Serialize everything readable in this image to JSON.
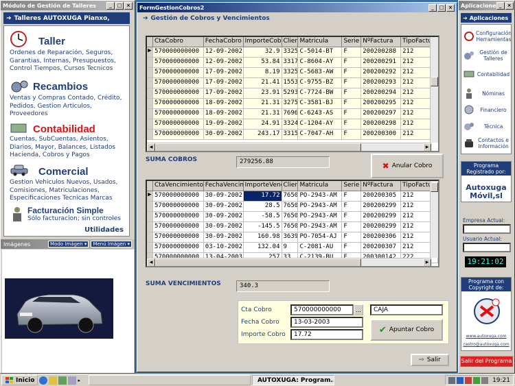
{
  "left_window": {
    "title": "Módulo de Gestión de Talleres",
    "header": "Talleres AUTOXUGA Pianxo,",
    "sections": [
      {
        "title": "Taller",
        "desc": "Ordenes de Reparación, Seguros, Garantias, Internas, Presupuestos, Control Tiempos, Cursos Tecnicos",
        "color": "#1f3d7a"
      },
      {
        "title": "Recambios",
        "desc": "Ventas y Compras Contado, Crédito, Pedidos,  Gestion Articulos, Proveedores",
        "color": "#1f3d7a"
      },
      {
        "title": "Contabilidad",
        "desc": "Cuentas, SubCuentas, Asientos, Diarios, Mayor, Balances, Listados Hacienda, Cobros y Pagos",
        "color": "#e01010"
      },
      {
        "title": "Comercial",
        "desc": "Gestion Vehiculos Nuevos, Usados, Comisiones, Matriculaciones, Especificaciones Tecnicas Marcas",
        "color": "#1f3d7a"
      },
      {
        "title": "Facturación Simple",
        "desc": "Sólo facturacion; sin controles",
        "color": "#1f3d7a"
      }
    ],
    "utilidades": "Utilidades",
    "images_bar": {
      "title": "Imágenes",
      "mode_btn": "Modo Imágen",
      "menu_btn": "Menú Imágen"
    }
  },
  "main_window": {
    "title": "FormGestionCobros2",
    "header": "Gestión de Cobros y Vencimientos",
    "cobros_columns": [
      "CtaCobro",
      "FechaCobro",
      "ImporteCobro",
      "Cliente",
      "Matricula",
      "Serie",
      "NºFactura",
      "TipoFactura"
    ],
    "cobros_rows": [
      [
        "570000000000",
        "12-09-2002",
        "32.9",
        "3325",
        "C-5014-BT",
        "F",
        "200200288",
        "212"
      ],
      [
        "570000000000",
        "12-09-2002",
        "53.84",
        "3317",
        "C-8604-AY",
        "F",
        "200200291",
        "212"
      ],
      [
        "570000000000",
        "17-09-2002",
        "8.19",
        "3325",
        "C-5683-AW",
        "F",
        "200200292",
        "212"
      ],
      [
        "570000000000",
        "17-09-2002",
        "21.41",
        "1553",
        "C-9755-BZ",
        "F",
        "200200293",
        "212"
      ],
      [
        "570000000000",
        "17-09-2002",
        "23.91",
        "5293",
        "C-7724-BW",
        "F",
        "200200294",
        "212"
      ],
      [
        "570000000000",
        "18-09-2002",
        "21.31",
        "3275",
        "C-3581-BJ",
        "F",
        "200200295",
        "212"
      ],
      [
        "570000000000",
        "18-09-2002",
        "21.31",
        "7696",
        "C-6243-AS",
        "F",
        "200200297",
        "212"
      ],
      [
        "570000000000",
        "19-09-2002",
        "24.91",
        "3324",
        "C-1204-AY",
        "F",
        "200200298",
        "212"
      ],
      [
        "570000000000",
        "30-09-2002",
        "243.17",
        "3315",
        "C-7047-AH",
        "F",
        "200200300",
        "212"
      ]
    ],
    "suma_cobros_label": "SUMA COBROS",
    "suma_cobros_value": "279256.88",
    "anular_label": "Anular Cobro",
    "venc_columns": [
      "CtaVencimiento",
      "FechaVencimiento",
      "ImporteVencimiento",
      "Cliente",
      "Matricula",
      "Serie",
      "NºFactura",
      "TipoFactura"
    ],
    "venc_rows": [
      [
        "570000000000",
        "30-09-2002",
        "17.72",
        "7650",
        "PO-2943-AM",
        "F",
        "200200305",
        "212"
      ],
      [
        "570000000000",
        "30-09-2002",
        "28.5",
        "7650",
        "PO-2943-AM",
        "F",
        "200200299",
        "212"
      ],
      [
        "570000000000",
        "30-09-2002",
        "-58.5",
        "7650",
        "PO-2943-AM",
        "F",
        "200200299",
        "212"
      ],
      [
        "570000000000",
        "30-09-2002",
        "-145.5",
        "7650",
        "PO-2943-AM",
        "F",
        "200200299",
        "212"
      ],
      [
        "570000000000",
        "30-09-2002",
        "160.98",
        "3639",
        "PO-7054-AJ",
        "F",
        "200200306",
        "212"
      ],
      [
        "570000000000",
        "03-10-2002",
        "132.04",
        "9",
        "C-2081-AU",
        "F",
        "200200307",
        "212"
      ],
      [
        "570000000000",
        "13-04-2003",
        "257",
        "33",
        "C-2139-BU",
        "F",
        "200300142",
        "222"
      ]
    ],
    "suma_venc_label": "SUMA VENCIMIENTOS",
    "suma_venc_value": "340.3",
    "cta_label": "Cta Cobro",
    "cta_value": "570000000000",
    "cta_btn": "...",
    "caja_value": "CAJA",
    "fecha_label": "Fecha Cobro",
    "fecha_value": "13-03-2003",
    "importe_label": "Importe Cobro",
    "importe_value": "17.72",
    "apuntar_label": "Apuntar Cobro",
    "salir_label": "Salir"
  },
  "right_window": {
    "title": "Aplicacione",
    "header": "Aplicaciones",
    "items": [
      "Configuración Herramientas",
      "Gestión de Talleres",
      "Contabilidad",
      "Nóminas",
      "Financiero",
      "Técnica",
      "Contactos e Información"
    ],
    "reg_title": "Programa Registrado por:",
    "reg_name1": "Autoxuga",
    "reg_name2": "Móvil,sl",
    "empresa_label": "Empresa Actual:",
    "usuario_label": "Usuario Actual:",
    "clock": "19:21:02",
    "copy_title": "Programa con Copyright de:",
    "url": "www.autoxuga.com",
    "email": "castro@autoxuga.com",
    "salir_prog": "Salir del Programa"
  },
  "taskbar": {
    "start": "Inicio",
    "task_active": "AUTOXUGA: Program...",
    "time": "19:21"
  }
}
